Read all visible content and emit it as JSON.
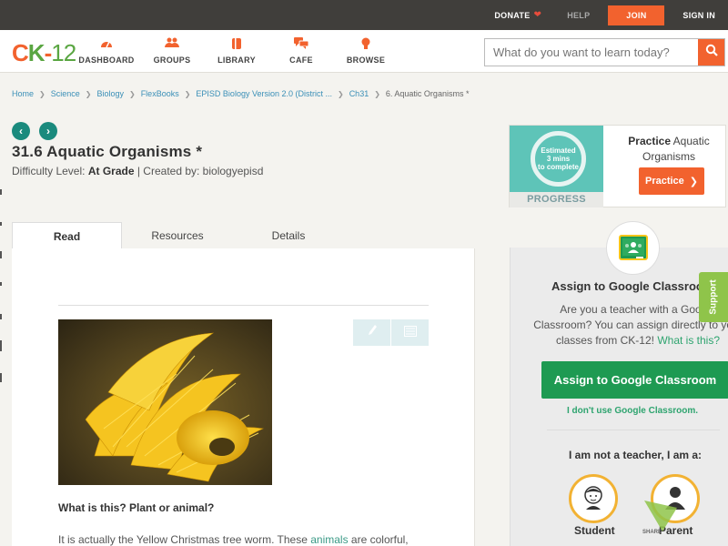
{
  "topbar": {
    "donate": "DONATE",
    "help": "HELP",
    "join": "JOIN",
    "signin": "SIGN IN"
  },
  "logo": {
    "c": "C",
    "k": "K",
    "dash": "-",
    "n": "12"
  },
  "nav": {
    "dashboard": "DASHBOARD",
    "groups": "GROUPS",
    "library": "LIBRARY",
    "cafe": "CAFE",
    "browse": "BROWSE"
  },
  "search": {
    "placeholder": "What do you want to learn today?"
  },
  "breadcrumb": {
    "home": "Home",
    "science": "Science",
    "biology": "Biology",
    "flexbooks": "FlexBooks",
    "episd": "EPISD Biology Version 2.0 (District ...",
    "ch31": "Ch31",
    "current": "6. Aquatic Organisms *"
  },
  "page": {
    "title": "31.6 Aquatic Organisms *",
    "difficulty_label": "Difficulty Level:",
    "difficulty_value": "At Grade",
    "created_by": "| Created by: biologyepisd"
  },
  "tabs": {
    "read": "Read",
    "resources": "Resources",
    "details": "Details"
  },
  "article": {
    "question": "What is this? Plant or animal?",
    "para_start": "It is actually the Yellow Christmas tree worm. These ",
    "para_link": "animals",
    "para_end": " are colorful,"
  },
  "practice": {
    "estimated": "Estimated",
    "mins": "3 mins",
    "to_complete": "to complete",
    "progress": "PROGRESS",
    "label_bold": "Practice",
    "label_rest": "Aquatic Organisms",
    "button": "Practice"
  },
  "classroom": {
    "title": "Assign to Google Classroom",
    "desc_1": "Are you a teacher with a Google",
    "desc_2": "Classroom? You can assign directly to your",
    "desc_3": "classes from CK-12! ",
    "desc_link": "What is this?",
    "button": "Assign to Google Classroom",
    "no_use": "I don't use Google Classroom.",
    "not_teacher": "I am not a teacher, I am a:",
    "student": "Student",
    "parent": "Parent"
  },
  "support": "Support",
  "share": "SHARE",
  "colors": {
    "brand_orange": "#f2622e",
    "brand_green": "#5aa642",
    "teal": "#1a8a7d",
    "classroom_green": "#1e9a52"
  },
  "icons": {
    "dashboard": "gauge-icon",
    "groups": "people-icon",
    "library": "book-icon",
    "cafe": "chat-bubbles-icon",
    "browse": "lightbulb-icon",
    "search": "magnifier-icon",
    "donate": "heart-icon"
  }
}
